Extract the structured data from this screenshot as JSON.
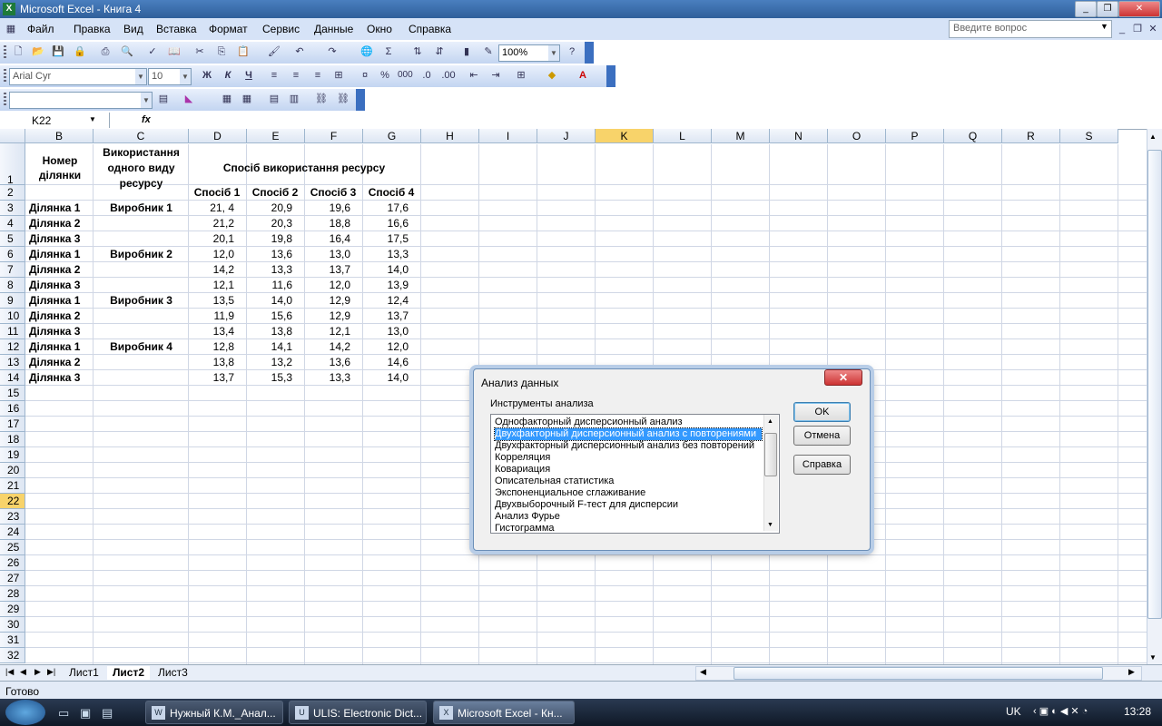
{
  "window": {
    "title": "Microsoft Excel - Книга 4"
  },
  "menu": [
    "Файл",
    "Правка",
    "Вид",
    "Вставка",
    "Формат",
    "Сервис",
    "Данные",
    "Окно",
    "Справка"
  ],
  "ask_placeholder": "Введите вопрос",
  "toolbar": {
    "zoom": "100%",
    "font": "Arial Cyr",
    "size": "10",
    "bold": "Ж",
    "italic": "К",
    "underline": "Ч",
    "percent": "%",
    "thousands": "000"
  },
  "formula_bar": {
    "name_box": "K22",
    "fx": "fx"
  },
  "columns": [
    "B",
    "C",
    "D",
    "E",
    "F",
    "G",
    "H",
    "I",
    "J",
    "K",
    "L",
    "M",
    "N",
    "O",
    "P",
    "Q",
    "R",
    "S"
  ],
  "active_col": "K",
  "rows": [
    "1",
    "2",
    "3",
    "4",
    "5",
    "6",
    "7",
    "8",
    "9",
    "10",
    "11",
    "12",
    "13",
    "14",
    "15",
    "16",
    "17",
    "18",
    "19",
    "20",
    "21",
    "22",
    "23",
    "24",
    "25",
    "26",
    "27",
    "28",
    "29",
    "30",
    "31",
    "32"
  ],
  "active_row": "22",
  "sheet": {
    "header_b": [
      "Номер",
      "ділянки"
    ],
    "header_c": [
      "Використання",
      "одного виду",
      "ресурсу"
    ],
    "header_dg": "Спосіб використання ресурсу",
    "methods": [
      "Спосіб 1",
      "Спосіб 2",
      "Спосіб 3",
      "Спосіб 4"
    ],
    "data": [
      {
        "plot": "Ділянка 1",
        "producer": "Виробник 1",
        "v": [
          "21, 4",
          "20,9",
          "19,6",
          "17,6"
        ]
      },
      {
        "plot": "Ділянка 2",
        "producer": "",
        "v": [
          "21,2",
          "20,3",
          "18,8",
          "16,6"
        ]
      },
      {
        "plot": "Ділянка 3",
        "producer": "",
        "v": [
          "20,1",
          "19,8",
          "16,4",
          "17,5"
        ]
      },
      {
        "plot": "Ділянка 1",
        "producer": "Виробник 2",
        "v": [
          "12,0",
          "13,6",
          "13,0",
          "13,3"
        ]
      },
      {
        "plot": "Ділянка 2",
        "producer": "",
        "v": [
          "14,2",
          "13,3",
          "13,7",
          "14,0"
        ]
      },
      {
        "plot": "Ділянка 3",
        "producer": "",
        "v": [
          "12,1",
          "11,6",
          "12,0",
          "13,9"
        ]
      },
      {
        "plot": "Ділянка 1",
        "producer": "Виробник 3",
        "v": [
          "13,5",
          "14,0",
          "12,9",
          "12,4"
        ]
      },
      {
        "plot": "Ділянка 2",
        "producer": "",
        "v": [
          "11,9",
          "15,6",
          "12,9",
          "13,7"
        ]
      },
      {
        "plot": "Ділянка 3",
        "producer": "",
        "v": [
          "13,4",
          "13,8",
          "12,1",
          "13,0"
        ]
      },
      {
        "plot": "Ділянка 1",
        "producer": "Виробник 4",
        "v": [
          "12,8",
          "14,1",
          "14,2",
          "12,0"
        ]
      },
      {
        "plot": "Ділянка 2",
        "producer": "",
        "v": [
          "13,8",
          "13,2",
          "13,6",
          "14,6"
        ]
      },
      {
        "plot": "Ділянка 3",
        "producer": "",
        "v": [
          "13,7",
          "15,3",
          "13,3",
          "14,0"
        ]
      }
    ]
  },
  "sheet_tabs": [
    "Лист1",
    "Лист2",
    "Лист3"
  ],
  "active_tab": "Лист2",
  "status": "Готово",
  "dialog": {
    "title": "Анализ данных",
    "group_label": "Инструменты анализа",
    "items": [
      "Однофакторный дисперсионный анализ",
      "Двухфакторный дисперсионный анализ с повторениями",
      "Двухфакторный дисперсионный анализ без повторений",
      "Корреляция",
      "Ковариация",
      "Описательная статистика",
      "Экспоненциальное сглаживание",
      "Двухвыборочный F-тест для дисперсии",
      "Анализ Фурье",
      "Гистограмма"
    ],
    "selected_index": 1,
    "ok": "OK",
    "cancel": "Отмена",
    "help": "Справка"
  },
  "taskbar": {
    "tasks": [
      "Нужный К.М._Анал...",
      "ULIS: Electronic Dict...",
      "Microsoft Excel - Кн..."
    ],
    "lang": "UK",
    "time": "13:28"
  }
}
